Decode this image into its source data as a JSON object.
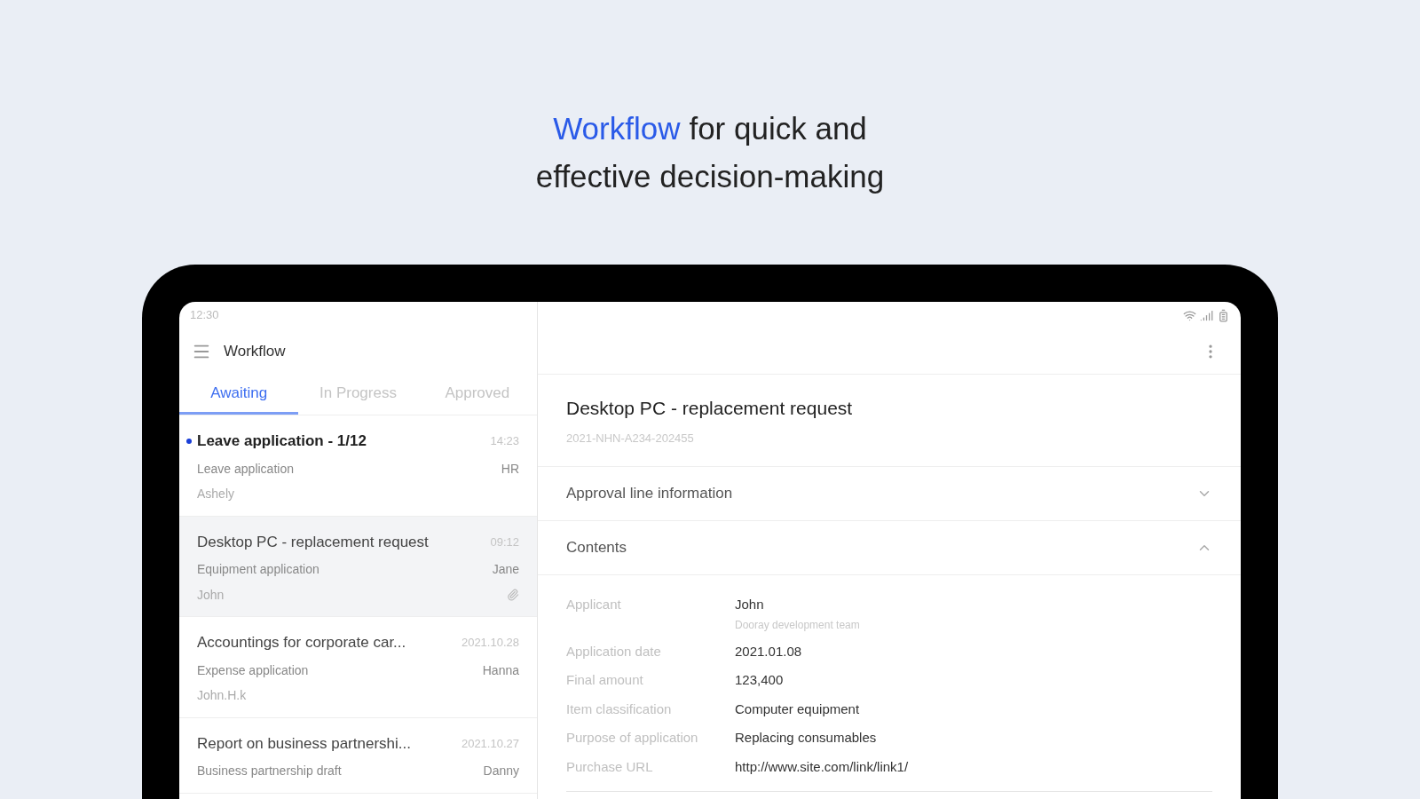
{
  "headline": {
    "highlight": "Workflow",
    "rest_line1": "for quick and",
    "line2": "effective decision-making"
  },
  "status_bar": {
    "time": "12:30"
  },
  "app_bar": {
    "title": "Workflow"
  },
  "tabs": [
    {
      "label": "Awaiting",
      "selected": true
    },
    {
      "label": "In Progress",
      "selected": false
    },
    {
      "label": "Approved",
      "selected": false
    }
  ],
  "items": [
    {
      "title": "Leave application - 1/12",
      "time": "14:23",
      "type": "Leave application",
      "owner": "HR",
      "applicant": "Ashely",
      "unread": true,
      "selected": false,
      "attachment": false
    },
    {
      "title": "Desktop PC - replacement request",
      "time": "09:12",
      "type": "Equipment application",
      "owner": "Jane",
      "applicant": "John",
      "unread": false,
      "selected": true,
      "attachment": true
    },
    {
      "title": "Accountings for corporate car...",
      "time": "2021.10.28",
      "type": "Expense application",
      "owner": "Hanna",
      "applicant": "John.H.k",
      "unread": false,
      "selected": false,
      "attachment": false
    },
    {
      "title": "Report on business partnershi...",
      "time": "2021.10.27",
      "type": "Business partnership draft",
      "owner": "Danny",
      "unread": false,
      "selected": false,
      "attachment": false
    }
  ],
  "detail": {
    "title": "Desktop PC - replacement request",
    "doc_number": "2021-NHN-A234-202455",
    "sections": [
      {
        "label": "Approval line information",
        "expanded": false
      },
      {
        "label": "Contents",
        "expanded": true
      }
    ],
    "fields": [
      {
        "label": "Applicant",
        "value": "John",
        "sub": "Dooray development team"
      },
      {
        "label": "Application date",
        "value": "2021.01.08"
      },
      {
        "label": "Final amount",
        "value": "123,400"
      },
      {
        "label": "Item classification",
        "value": "Computer equipment"
      },
      {
        "label": "Purpose of application",
        "value": "Replacing consumables"
      },
      {
        "label": "Purchase URL",
        "value": "http://www.site.com/link/link1/"
      }
    ]
  }
}
